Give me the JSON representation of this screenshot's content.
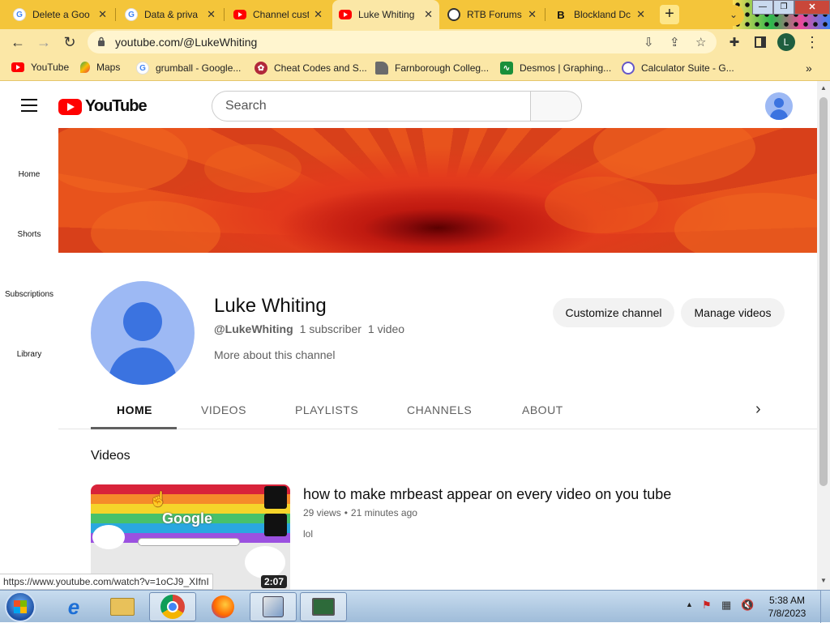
{
  "browser": {
    "tabs": [
      {
        "label": "Delete a Goo",
        "icon": "google-icon",
        "active": false
      },
      {
        "label": "Data & priva",
        "icon": "google-icon",
        "active": false
      },
      {
        "label": "Channel cust",
        "icon": "youtube-icon",
        "active": false
      },
      {
        "label": "Luke Whiting",
        "icon": "youtube-icon",
        "active": true
      },
      {
        "label": "RTB Forums",
        "icon": "rtb-icon",
        "active": false
      },
      {
        "label": "Blockland Dc",
        "icon": "blockland-icon",
        "active": false
      }
    ],
    "new_tab": "+",
    "address": "youtube.com/@LukeWhiting",
    "profile_initial": "L",
    "bookmarks": [
      {
        "label": "YouTube",
        "icon": "youtube-icon"
      },
      {
        "label": "Maps",
        "icon": "maps-icon"
      },
      {
        "label": "grumball - Google...",
        "icon": "google-icon"
      },
      {
        "label": "Cheat Codes and S...",
        "icon": "cheat-codes-icon"
      },
      {
        "label": "Farnborough Colleg...",
        "icon": "college-icon"
      },
      {
        "label": "Desmos | Graphing...",
        "icon": "desmos-icon"
      },
      {
        "label": "Calculator Suite - G...",
        "icon": "geogebra-icon"
      }
    ],
    "bookmarks_more": "»",
    "status_url": "https://www.youtube.com/watch?v=1oCJ9_XIfnI"
  },
  "youtube": {
    "logo_text": "YouTube",
    "search_placeholder": "Search",
    "left_nav": [
      "Home",
      "Shorts",
      "Subscriptions",
      "Library"
    ],
    "channel": {
      "name": "Luke Whiting",
      "handle": "@LukeWhiting",
      "subscribers": "1 subscriber",
      "videos_count": "1 video",
      "more_about": "More about this channel",
      "customize_button": "Customize channel",
      "manage_button": "Manage videos"
    },
    "tabs": [
      "HOME",
      "VIDEOS",
      "PLAYLISTS",
      "CHANNELS",
      "ABOUT"
    ],
    "active_tab": "HOME",
    "section_title": "Videos",
    "video": {
      "title": "how to make mrbeast appear on every video on you tube",
      "views": "29 views",
      "age": "21 minutes ago",
      "description": "lol",
      "duration": "2:07",
      "thumb_text": "Google"
    }
  },
  "taskbar": {
    "time": "5:38 AM",
    "date": "7/8/2023",
    "apps": [
      "internet-explorer-icon",
      "file-explorer-icon",
      "chrome-icon",
      "firefox-icon",
      "control-panel-icon",
      "monitor-app-icon"
    ]
  },
  "colors": {
    "tab_bar": "#f4c53a",
    "toolbar": "#fbe7a6",
    "youtube_red": "#ff0000",
    "avatar_blue": "#3b73e0"
  }
}
